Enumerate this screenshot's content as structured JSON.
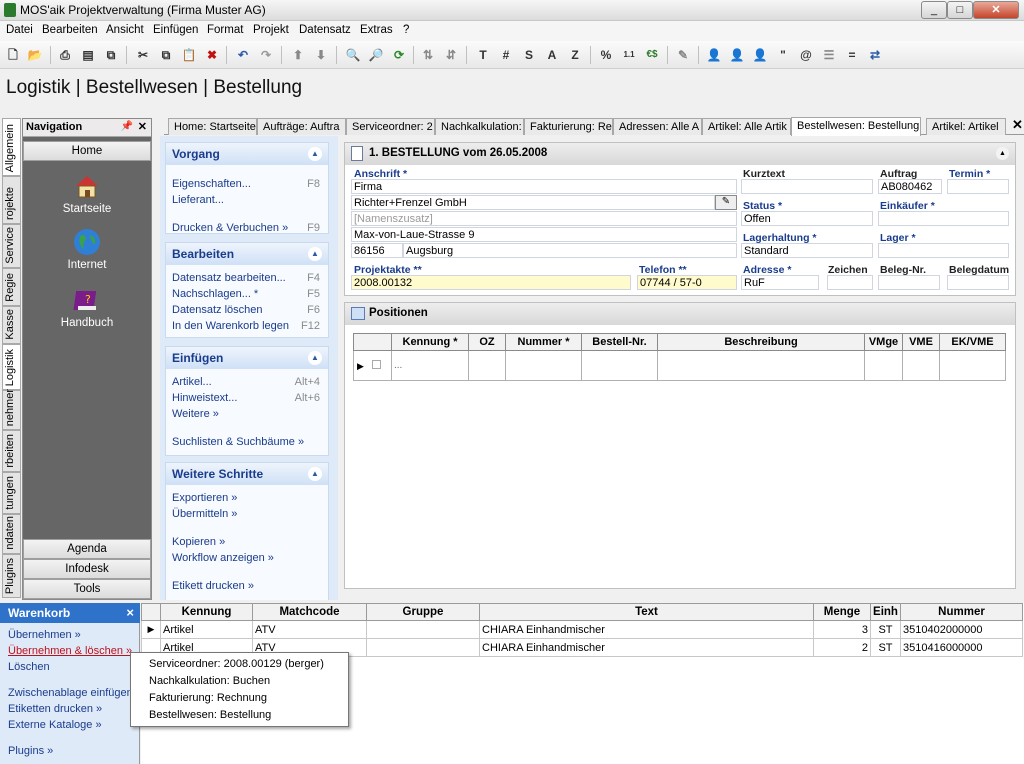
{
  "window": {
    "title": "MOS'aik Projektverwaltung (Firma Muster AG)",
    "min": "_",
    "max": "□",
    "close": "✕"
  },
  "menu": [
    "Datei",
    "Bearbeiten",
    "Ansicht",
    "Einfügen",
    "Format",
    "Projekt",
    "Datensatz",
    "Extras",
    "?"
  ],
  "toolbar": {
    "letters": [
      "T",
      "#",
      "S",
      "A",
      "Z",
      "%",
      "€$",
      "\""
    ]
  },
  "page_title": "Logistik | Bestellwesen | Bestellung",
  "vtabs": [
    "Allgemein",
    "rojekte",
    "Service",
    "Regie",
    "Kasse",
    "Logistik",
    "nehmer",
    "rbeiten",
    "tungen",
    "ndaten",
    "Plugins"
  ],
  "nav": {
    "title": "Navigation",
    "home": "Home",
    "items": [
      "Startseite",
      "Internet",
      "Handbuch"
    ],
    "bottom": [
      "Agenda",
      "Infodesk",
      "Tools"
    ]
  },
  "tasks": {
    "vorgang": {
      "title": "Vorgang",
      "links": [
        "Eigenschaften...",
        "Lieferant...",
        "Drucken & Verbuchen »"
      ],
      "keys": [
        "F8",
        "F9"
      ]
    },
    "bearbeiten": {
      "title": "Bearbeiten",
      "links": [
        "Datensatz bearbeiten...",
        "Nachschlagen... *",
        "Datensatz löschen",
        "In den Warenkorb legen"
      ],
      "keys": [
        "F4",
        "F5",
        "F6",
        "F12"
      ]
    },
    "einfuegen": {
      "title": "Einfügen",
      "links": [
        "Artikel...",
        "Hinweistext...",
        "Weitere »",
        "Suchlisten & Suchbäume »"
      ],
      "keys": [
        "Alt+4",
        "Alt+6"
      ]
    },
    "weitere": {
      "title": "Weitere Schritte",
      "links": [
        "Exportieren »",
        "Übermitteln »",
        "Kopieren »",
        "Workflow anzeigen »",
        "Etikett drucken »"
      ]
    }
  },
  "doctabs": [
    "Home: Startseite",
    "Aufträge: Auftra",
    "Serviceordner: 2",
    "Nachkalkulation:",
    "Fakturierung: Re",
    "Adressen: Alle A",
    "Artikel: Alle Artik",
    "Bestellwesen: Bestellung",
    "Artikel: Artikel"
  ],
  "form": {
    "heading": "1. BESTELLUNG vom 26.05.2008",
    "labels": {
      "anschrift": "Anschrift *",
      "kurztext": "Kurztext",
      "auftrag": "Auftrag",
      "termin": "Termin *",
      "status": "Status *",
      "einkaeufer": "Einkäufer *",
      "lagerhaltung": "Lagerhaltung *",
      "lager": "Lager *",
      "projektakte": "Projektakte **",
      "telefon": "Telefon **",
      "adresse": "Adresse *",
      "zeichen": "Zeichen",
      "belegnr": "Beleg-Nr.",
      "belegdatum": "Belegdatum"
    },
    "values": {
      "anrede": "Firma",
      "firma": "Richter+Frenzel GmbH",
      "zusatz": "[Namenszusatz]",
      "strasse": "Max-von-Laue-Strasse 9",
      "plz": "86156",
      "ort": "Augsburg",
      "auftrag": "AB080462",
      "status": "Offen",
      "lagerhaltung": "Standard",
      "projektakte": "2008.00132",
      "telefon": "07744 / 57-0",
      "adresse": "RuF"
    }
  },
  "positions": {
    "title": "Positionen",
    "columns": [
      "Kennung *",
      "OZ",
      "Nummer *",
      "Bestell-Nr.",
      "Beschreibung",
      "VMge",
      "VME",
      "EK/VME"
    ],
    "row_placeholder": "..."
  },
  "basket": {
    "title": "Warenkorb",
    "close": "×",
    "links": [
      "Übernehmen »",
      "Übernehmen & löschen »",
      "Löschen",
      "Zwischenablage einfügen",
      "Etiketten drucken »",
      "Externe Kataloge »",
      "Plugins »"
    ]
  },
  "basket_grid": {
    "columns": [
      "Kennung",
      "Matchcode",
      "Gruppe",
      "Text",
      "Menge",
      "Einh",
      "Nummer"
    ],
    "rows": [
      [
        "Artikel",
        "ATV",
        "",
        "CHIARA Einhandmischer",
        "3",
        "ST",
        "3510402000000"
      ],
      [
        "Artikel",
        "ATV",
        "",
        "CHIARA Einhandmischer",
        "2",
        "ST",
        "3510416000000"
      ]
    ]
  },
  "popup": [
    "Serviceordner: 2008.00129 (berger)",
    "Nachkalkulation: Buchen",
    "Fakturierung: Rechnung",
    "Bestellwesen: Bestellung"
  ]
}
